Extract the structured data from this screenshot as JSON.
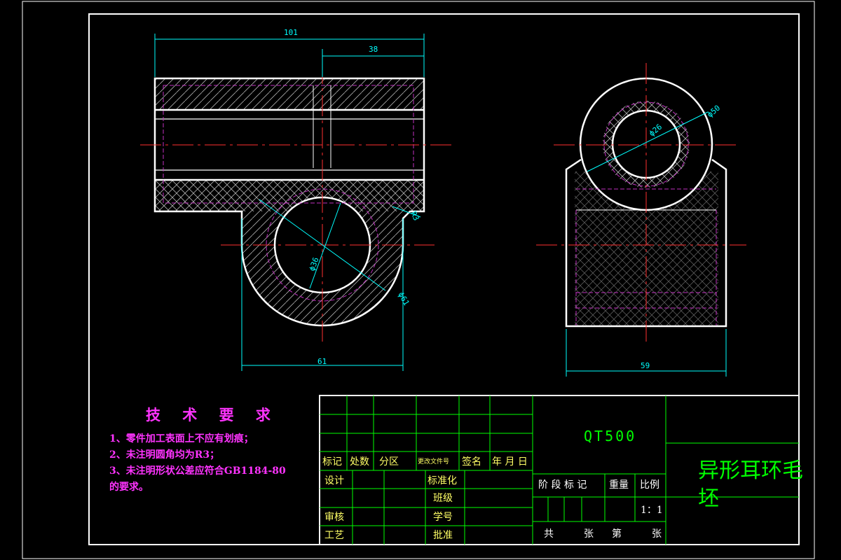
{
  "drawing": {
    "dimensions": {
      "overall_length": "101",
      "hole_offset": "38",
      "base_width": "61",
      "bore_small": "ϕ36",
      "outer_radius_dia": "ϕ61",
      "fillet": "R3",
      "side_bore": "ϕ26",
      "side_outer": "ϕ50",
      "side_width": "59"
    },
    "technical_requirements": {
      "heading": "技 术 要 求",
      "items": [
        "1、零件加工表面上不应有划痕；",
        "2、未注明圆角均为R3；",
        "3、未注明形状公差应符合GB1184-80",
        "的要求。"
      ]
    },
    "title_block": {
      "material": "QT500",
      "part_name_line1": "异形耳环毛",
      "part_name_line2": "坯",
      "rev_headers": [
        "标记",
        "处数",
        "分区",
        "更改文件号",
        "签名",
        "年 月 日"
      ],
      "design": "设计",
      "standardize": "标准化",
      "class": "班级",
      "check": "审核",
      "student_no": "学号",
      "process": "工艺",
      "approve": "批准",
      "stage_mark": "阶 段 标 记",
      "weight": "重量",
      "scale_label": "比例",
      "scale_value": "1：1",
      "total_label": "共",
      "sheet_unit1": "张",
      "sheet_label": "第",
      "sheet_unit2": "张"
    }
  }
}
